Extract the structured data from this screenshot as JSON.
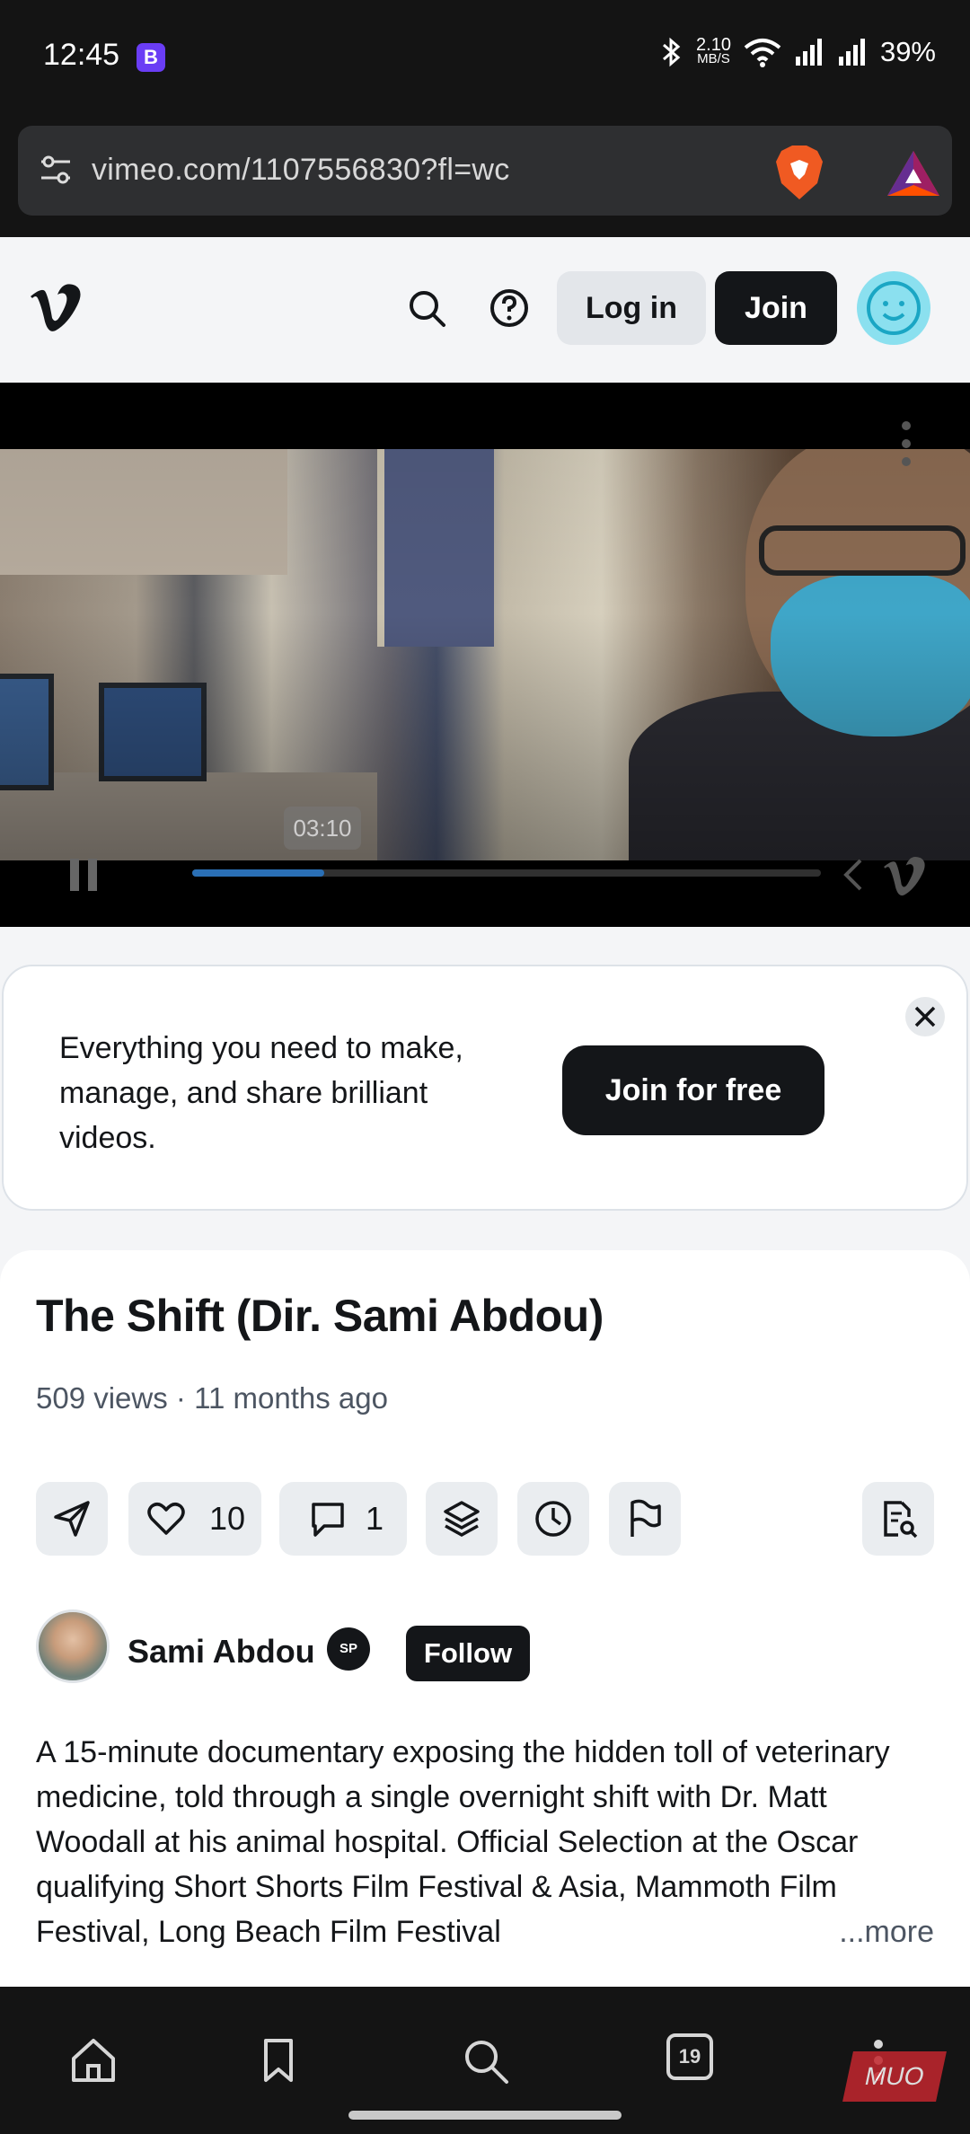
{
  "status_bar": {
    "time": "12:45",
    "notification_badge": "B",
    "net_speed_value": "2.10",
    "net_speed_unit": "MB/S",
    "battery": "39%"
  },
  "browser": {
    "url": "vimeo.com/1107556830?fl=wc",
    "tab_count": "19"
  },
  "header": {
    "login_label": "Log in",
    "join_label": "Join"
  },
  "player": {
    "tooltip_time": "03:10",
    "progress": 0.21
  },
  "promo": {
    "text": "Everything you need to make, manage, and share brilliant videos.",
    "cta_label": "Join for free"
  },
  "video": {
    "title": "The Shift (Dir. Sami Abdou)",
    "meta": "509 views · 11 months ago",
    "likes": "10",
    "comments": "1",
    "creator_name": "Sami Abdou",
    "creator_badge": "SP",
    "follow_label": "Follow",
    "description": "A 15-minute documentary exposing the hidden toll of veterinary medicine, told through a single overnight shift with Dr. Matt Woodall at his animal hospital. Official Selection at the Oscar qualifying Short Shorts Film Festival & Asia, Mammoth Film Festival, Long Beach Film Festival",
    "more_label": "...more"
  },
  "watermark": "MUO",
  "colors": {
    "brand_dark": "#141619",
    "avatar_accent": "#8be0ef",
    "progress": "#2a6fb5"
  }
}
